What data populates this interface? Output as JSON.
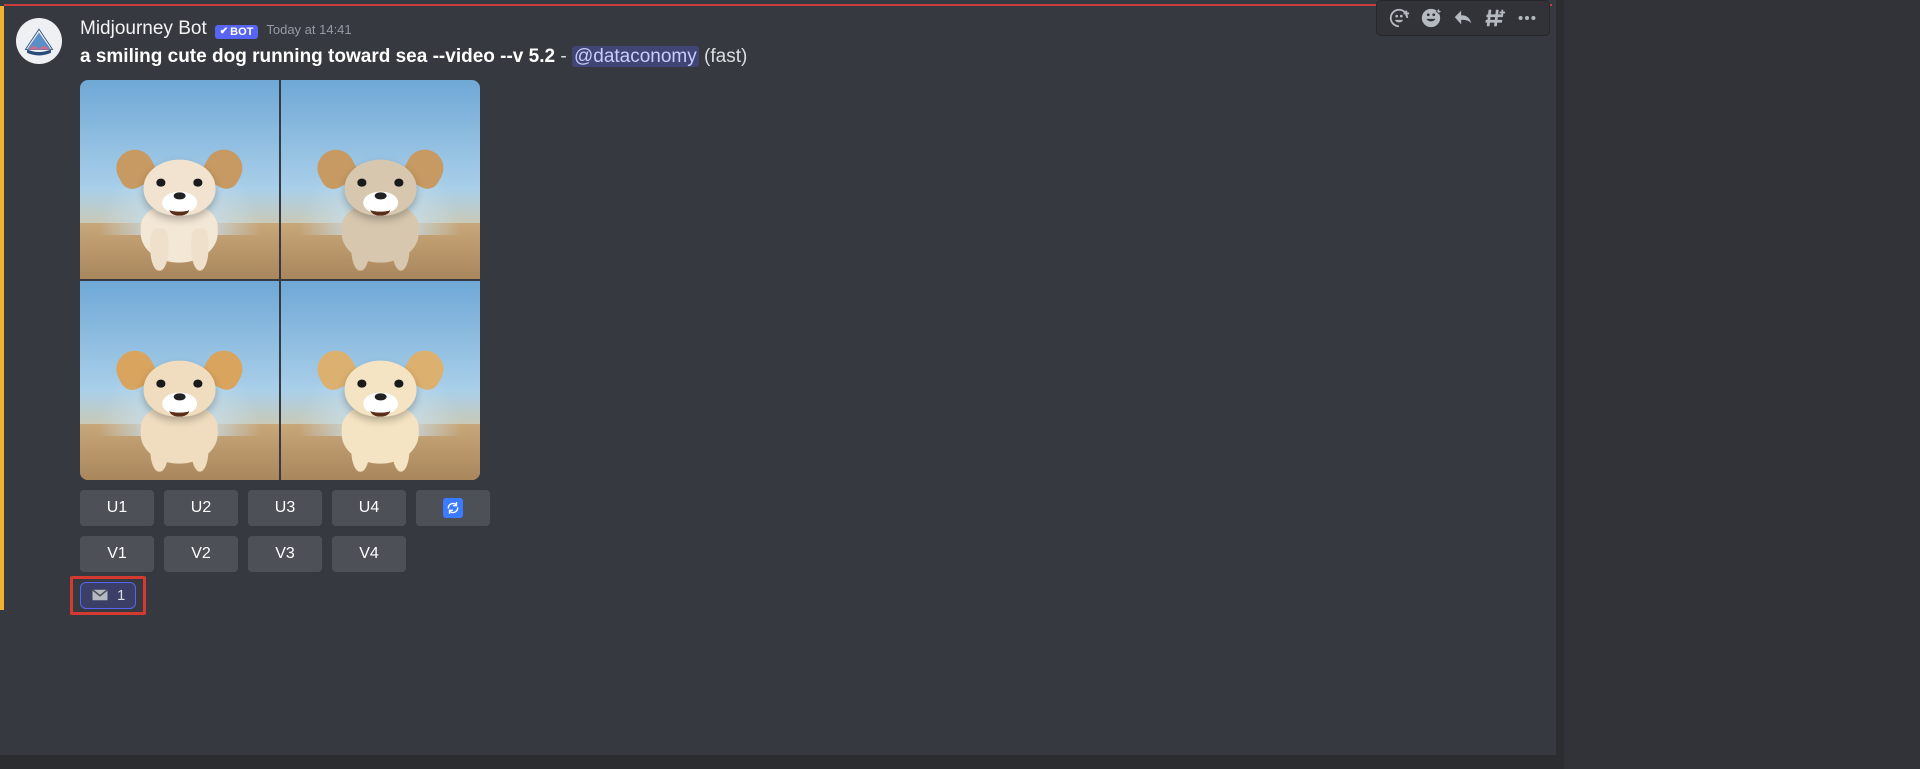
{
  "author": {
    "name": "Midjourney Bot",
    "bot_label": "BOT"
  },
  "timestamp": "Today at 14:41",
  "content": {
    "prompt": "a smiling cute dog running toward sea --video --v 5.2",
    "separator": "-",
    "mention": "@dataconomy",
    "mode": "(fast)"
  },
  "buttons": {
    "row1": [
      "U1",
      "U2",
      "U3",
      "U4"
    ],
    "row2": [
      "V1",
      "V2",
      "V3",
      "V4"
    ],
    "refresh_name": "refresh-icon"
  },
  "reaction": {
    "icon": "envelope-icon",
    "count": "1"
  },
  "hover_actions": [
    "add-reaction-icon",
    "super-reaction-icon",
    "reply-icon",
    "create-thread-icon",
    "more-icon"
  ]
}
